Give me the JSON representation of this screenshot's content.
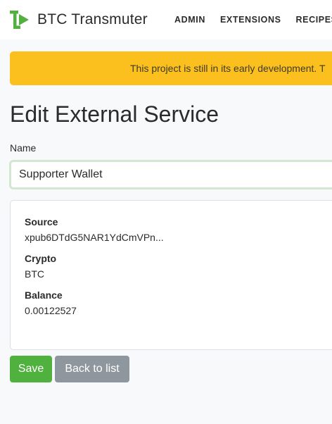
{
  "app": {
    "name": "BTC Transmuter",
    "brand_color": "#51b13e"
  },
  "nav": {
    "items": [
      {
        "label": "ADMIN"
      },
      {
        "label": "EXTENSIONS"
      },
      {
        "label": "RECIPES"
      }
    ]
  },
  "banner": {
    "text": "This project is still in its early development. T",
    "color": "#fcc01e"
  },
  "page": {
    "title": "Edit External Service"
  },
  "form": {
    "name_label": "Name",
    "name_value": "Supporter Wallet"
  },
  "details": {
    "source_label": "Source",
    "source_value": "xpub6DTdG5NAR1YdCmVPn...",
    "crypto_label": "Crypto",
    "crypto_value": "BTC",
    "balance_label": "Balance",
    "balance_value": "0.00122527"
  },
  "actions": {
    "save_label": "Save",
    "back_label": "Back to list"
  }
}
